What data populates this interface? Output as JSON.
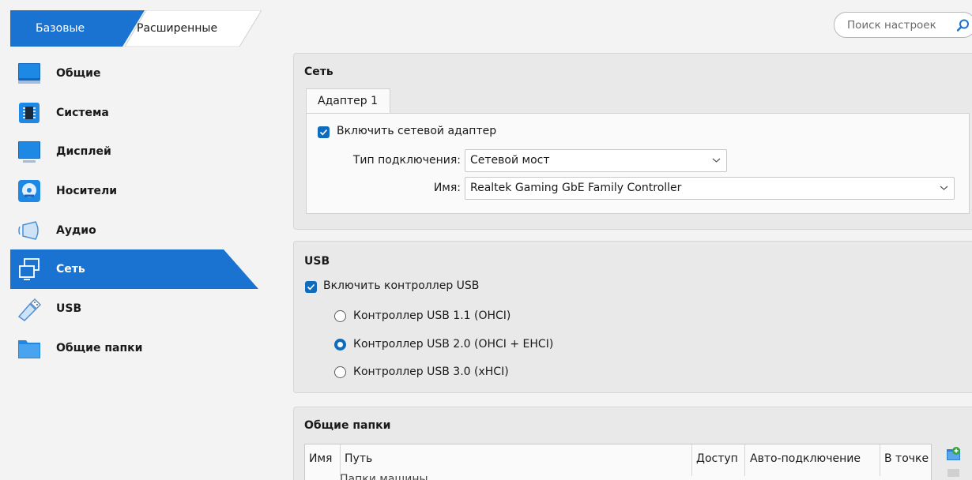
{
  "mode_tabs": {
    "basic": "Базовые",
    "expert": "Расширенные"
  },
  "search": {
    "placeholder": "Поиск настроек"
  },
  "sidebar": {
    "items": [
      {
        "label": "Общие",
        "icon": "general-icon"
      },
      {
        "label": "Система",
        "icon": "system-chip-icon"
      },
      {
        "label": "Дисплей",
        "icon": "display-monitor-icon"
      },
      {
        "label": "Носители",
        "icon": "storage-disc-icon"
      },
      {
        "label": "Аудио",
        "icon": "audio-speaker-icon"
      },
      {
        "label": "Сеть",
        "icon": "network-icon",
        "selected": true
      },
      {
        "label": "USB",
        "icon": "usb-plug-icon"
      },
      {
        "label": "Общие папки",
        "icon": "shared-folder-icon"
      }
    ]
  },
  "network": {
    "title": "Сеть",
    "adapter_tab": "Адаптер 1",
    "enable_label": "Включить сетевой адаптер",
    "enable_checked": true,
    "attach_label": "Тип подключения:",
    "attach_value": "Сетевой мост",
    "name_label": "Имя:",
    "name_value": "Realtek Gaming GbE Family Controller"
  },
  "usb": {
    "title": "USB",
    "enable_label": "Включить контроллер USB",
    "enable_checked": true,
    "options": [
      {
        "label": "Контроллер USB 1.1 (OHCI)",
        "selected": false
      },
      {
        "label": "Контроллер USB 2.0 (OHCI + EHCI)",
        "selected": true
      },
      {
        "label": "Контроллер USB 3.0 (xHCI)",
        "selected": false
      }
    ]
  },
  "shared_folders": {
    "title": "Общие папки",
    "columns": [
      "Имя",
      "Путь",
      "Доступ",
      "Авто-подключение",
      "В точке"
    ],
    "rows": [
      "Папки машины"
    ]
  },
  "colors": {
    "accent": "#0f6cbd",
    "selection": "#1a73d0"
  }
}
